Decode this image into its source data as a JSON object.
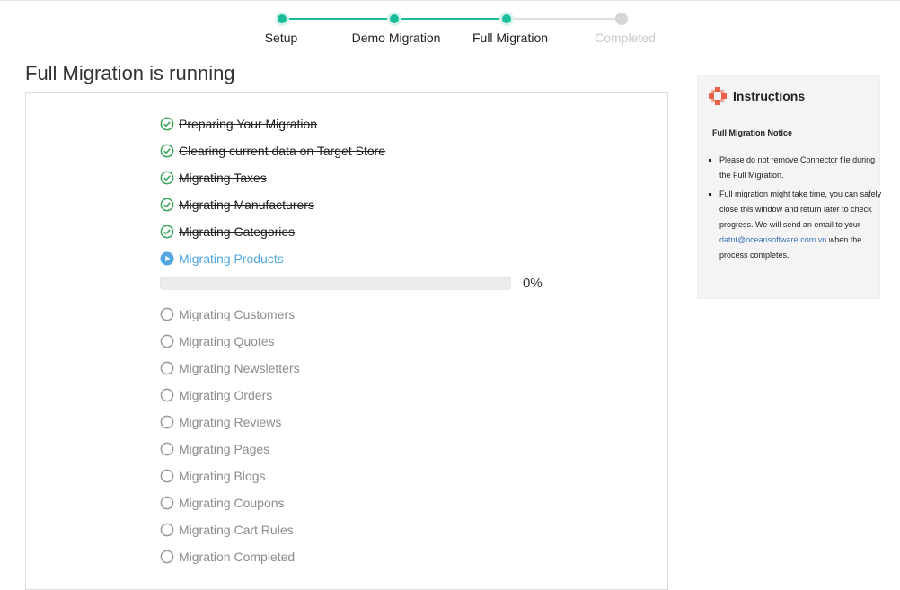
{
  "stepper": {
    "steps": [
      {
        "label": "Setup",
        "status": "done"
      },
      {
        "label": "Demo Migration",
        "status": "done"
      },
      {
        "label": "Full Migration",
        "status": "done"
      },
      {
        "label": "Completed",
        "status": "pending"
      }
    ],
    "active_color": "#1abc9c",
    "pending_color": "#d6d6d6"
  },
  "page_title": "Full Migration is running",
  "tasks": [
    {
      "label": "Preparing Your Migration",
      "status": "done"
    },
    {
      "label": "Clearing current data on Target Store",
      "status": "done"
    },
    {
      "label": "Migrating Taxes",
      "status": "done"
    },
    {
      "label": "Migrating Manufacturers",
      "status": "done"
    },
    {
      "label": "Migrating Categories",
      "status": "done"
    },
    {
      "label": "Migrating Products",
      "status": "active"
    },
    {
      "label": "Migrating Customers",
      "status": "pending"
    },
    {
      "label": "Migrating Quotes",
      "status": "pending"
    },
    {
      "label": "Migrating Newsletters",
      "status": "pending"
    },
    {
      "label": "Migrating Orders",
      "status": "pending"
    },
    {
      "label": "Migrating Reviews",
      "status": "pending"
    },
    {
      "label": "Migrating Pages",
      "status": "pending"
    },
    {
      "label": "Migrating Blogs",
      "status": "pending"
    },
    {
      "label": "Migrating Coupons",
      "status": "pending"
    },
    {
      "label": "Migrating Cart Rules",
      "status": "pending"
    },
    {
      "label": "Migration Completed",
      "status": "pending"
    }
  ],
  "progress": {
    "value": 0,
    "text": "0%"
  },
  "colors": {
    "done": "#3aa55a",
    "active": "#4fa6e0",
    "pending": "#9a9a9a"
  },
  "icons": {
    "done": "check-circle-icon",
    "active": "play-circle-icon",
    "pending": "empty-circle-icon",
    "instructions": "lifebuoy-icon"
  },
  "instructions": {
    "title": "Instructions",
    "subtitle": "Full Migration Notice",
    "item1": "Please do not remove Connector file during the Full Migration.",
    "item2_before": "Full migration might take time, you can safely close this window and return later to check progress. We will send an email to your ",
    "email": "datnt@oceansoftware.com.vn",
    "item2_after": " when the process completes."
  }
}
